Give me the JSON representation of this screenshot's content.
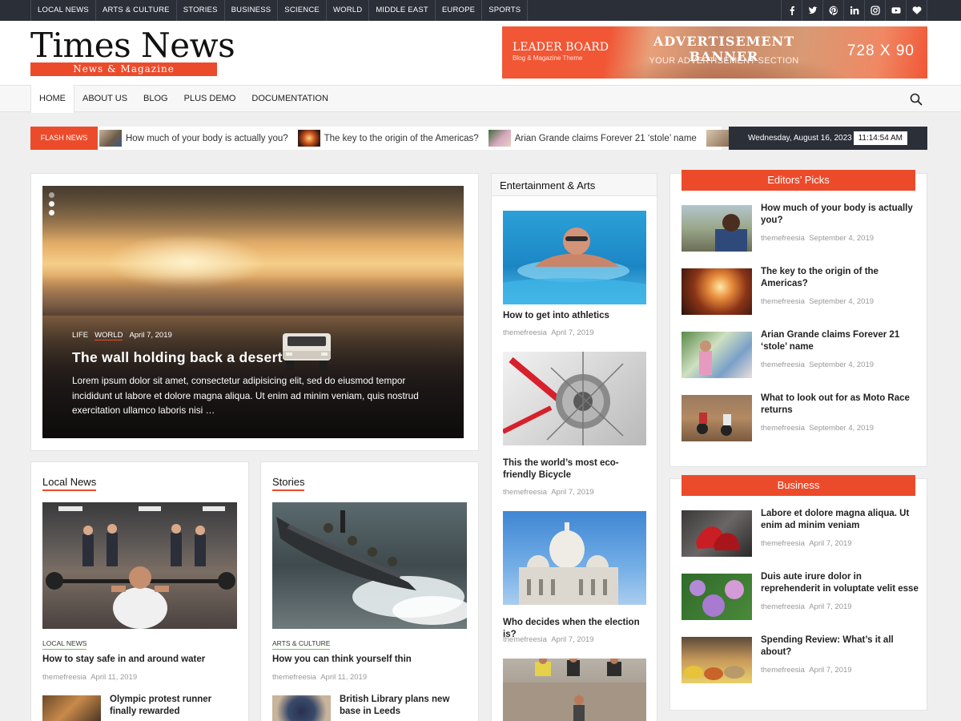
{
  "topnav": [
    "LOCAL NEWS",
    "ARTS & CULTURE",
    "STORIES",
    "BUSINESS",
    "SCIENCE",
    "WORLD",
    "MIDDLE EAST",
    "EUROPE",
    "SPORTS"
  ],
  "social": [
    "facebook-icon",
    "twitter-icon",
    "pinterest-icon",
    "linkedin-icon",
    "instagram-icon",
    "youtube-icon",
    "heart-icon"
  ],
  "logo": {
    "title": "Times News",
    "tagline": "News & Magazine"
  },
  "ad": {
    "leader": "LEADER BOARD",
    "leader_sub": "Blog & Magazine Theme",
    "title": "ADVERTISEMENT BANNER",
    "subtitle": "YOUR ADVERTISEMENT SECTION",
    "size": "728 X 90"
  },
  "mainnav": [
    "HOME",
    "ABOUT US",
    "BLOG",
    "PLUS DEMO",
    "DOCUMENTATION"
  ],
  "flash": {
    "label": "FLASH NEWS",
    "items": [
      "How much of your body is actually you?",
      "The key to the origin of the Americas?",
      "Arian Grande claims Forever 21 ‘stole’ name"
    ]
  },
  "datetime": {
    "date": "Wednesday, August 16, 2023",
    "time": "11:14:54 AM"
  },
  "hero": {
    "cat1": "LIFE",
    "cat2": "WORLD",
    "date": "April 7, 2019",
    "title": "The wall holding back a desert",
    "excerpt": "Lorem ipsum dolor sit amet, consectetur adipisicing elit, sed do eiusmod tempor incididunt ut labore et dolore magna aliqua. Ut enim ad minim veniam, quis nostrud exercitation ullamco laboris nisi …"
  },
  "local": {
    "title": "Local News",
    "cat": "LOCAL NEWS",
    "post": "How to stay safe in and around water",
    "author": "themefreesia",
    "date": "April 11, 2019",
    "small": "Olympic protest runner finally rewarded"
  },
  "stories": {
    "title": "Stories",
    "cat": "ARTS & CULTURE",
    "post": "How you can think yourself thin",
    "author": "themefreesia",
    "date": "April 11, 2019",
    "small": "British Library plans new base in Leeds"
  },
  "ent": {
    "title": "Entertainment & Arts",
    "posts": [
      {
        "title": "How to get into athletics",
        "author": "themefreesia",
        "date": "April 7, 2019"
      },
      {
        "title": "This the world’s most eco-friendly Bicycle",
        "author": "themefreesia",
        "date": "April 7, 2019"
      },
      {
        "title": "Who decides when the election is?",
        "author": "themefreesia",
        "date": "April 7, 2019"
      }
    ]
  },
  "editors": {
    "title": "Editors’ Picks",
    "posts": [
      {
        "title": "How much of your body is actually you?",
        "author": "themefreesia",
        "date": "September 4, 2019"
      },
      {
        "title": "The key to the origin of the Americas?",
        "author": "themefreesia",
        "date": "September 4, 2019"
      },
      {
        "title": "Arian Grande claims Forever 21 ‘stole’ name",
        "author": "themefreesia",
        "date": "September 4, 2019"
      },
      {
        "title": "What to look out for as Moto Race returns",
        "author": "themefreesia",
        "date": "September 4, 2019"
      }
    ]
  },
  "business": {
    "title": "Business",
    "posts": [
      {
        "title": "Labore et dolore magna aliqua. Ut enim ad minim veniam",
        "author": "themefreesia",
        "date": "April 7, 2019"
      },
      {
        "title": "Duis aute irure dolor in reprehenderit in voluptate velit esse",
        "author": "themefreesia",
        "date": "April 7, 2019"
      },
      {
        "title": "Spending Review: What’s it all about?",
        "author": "themefreesia",
        "date": "April 7, 2019"
      }
    ]
  },
  "colors": {
    "accent": "#ec4b2b",
    "dark": "#2b2f38",
    "green": "#7dc244"
  }
}
